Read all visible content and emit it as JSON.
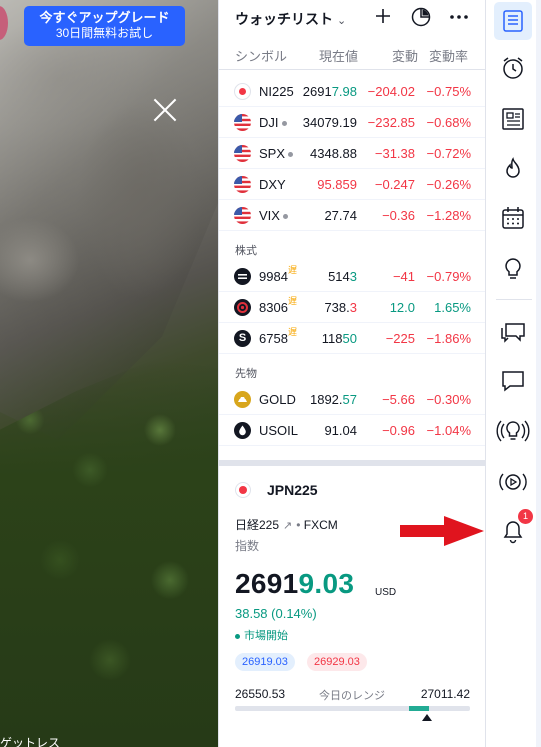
{
  "promo": {
    "line1": "今すぐアップグレード",
    "line2": "30日間無料お試し"
  },
  "photo_caption": "ゲットレス",
  "watchlist": {
    "title": "ウォッチリスト",
    "columns": {
      "symbol": "シンボル",
      "last": "現在値",
      "change": "変動",
      "change_pct": "変動率"
    },
    "indices": [
      {
        "symbol": "NI225",
        "last_main": "2691",
        "last_tail": "7.98",
        "tail_color": "#089981",
        "change": "−204.02",
        "pct": "−0.75%",
        "dir": "down",
        "icon": "red-dot-icon"
      },
      {
        "symbol": "DJI",
        "last_main": "34079.19",
        "last_tail": "",
        "tail_color": "#131722",
        "change": "−232.85",
        "pct": "−0.68%",
        "dir": "down",
        "icon": "us-flag-icon"
      },
      {
        "symbol": "SPX",
        "last_main": "4348.88",
        "last_tail": "",
        "tail_color": "#131722",
        "change": "−31.38",
        "pct": "−0.72%",
        "dir": "down",
        "icon": "us-flag-icon"
      },
      {
        "symbol": "DXY",
        "last_main": "95.859",
        "last_tail": "",
        "tail_color": "#f23645",
        "change": "−0.247",
        "pct": "−0.26%",
        "dir": "down",
        "icon": "us-flag-icon"
      },
      {
        "symbol": "VIX",
        "last_main": "27.74",
        "last_tail": "",
        "tail_color": "#131722",
        "change": "−0.36",
        "pct": "−1.28%",
        "dir": "down",
        "icon": "us-flag-icon"
      }
    ],
    "section_stocks": "株式",
    "stocks": [
      {
        "symbol": "9984",
        "last_main": "514",
        "last_tail": "3",
        "tail_color": "#089981",
        "change": "−41",
        "pct": "−0.79%",
        "dir": "down"
      },
      {
        "symbol": "8306",
        "last_main": "738.",
        "last_tail": "3",
        "tail_color": "#f23645",
        "change": "12.0",
        "pct": "1.65%",
        "dir": "up"
      },
      {
        "symbol": "6758",
        "last_main": "118",
        "last_tail": "50",
        "tail_color": "#089981",
        "change": "−225",
        "pct": "−1.86%",
        "dir": "down"
      }
    ],
    "delay_mark": "遅",
    "section_futures": "先物",
    "futures": [
      {
        "symbol": "GOLD",
        "last_main": "1892.",
        "last_tail": "57",
        "tail_color": "#089981",
        "change": "−5.66",
        "pct": "−0.30%",
        "dir": "down"
      },
      {
        "symbol": "USOIL",
        "last_main": "91.04",
        "last_tail": "",
        "tail_color": "#131722",
        "change": "−0.96",
        "pct": "−1.04%",
        "dir": "down"
      }
    ]
  },
  "detail": {
    "symbol": "JPN225",
    "description": "日経225",
    "exchange": "FXCM",
    "kind": "指数",
    "price_main": "2691",
    "price_tail": "9.03",
    "currency": "USD",
    "change": "38.58 (0.14%)",
    "market_status": "市場開始",
    "bid": "26919.03",
    "ask": "26929.03",
    "range_low": "26550.53",
    "range_label": "今日のレンジ",
    "range_high": "27011.42",
    "range_current": 26919.03
  },
  "sidebar": {
    "notification_count": "1"
  },
  "colors": {
    "accent": "#2962ff",
    "up": "#089981",
    "down": "#f23645",
    "annotation_arrow": "#e0141e"
  }
}
